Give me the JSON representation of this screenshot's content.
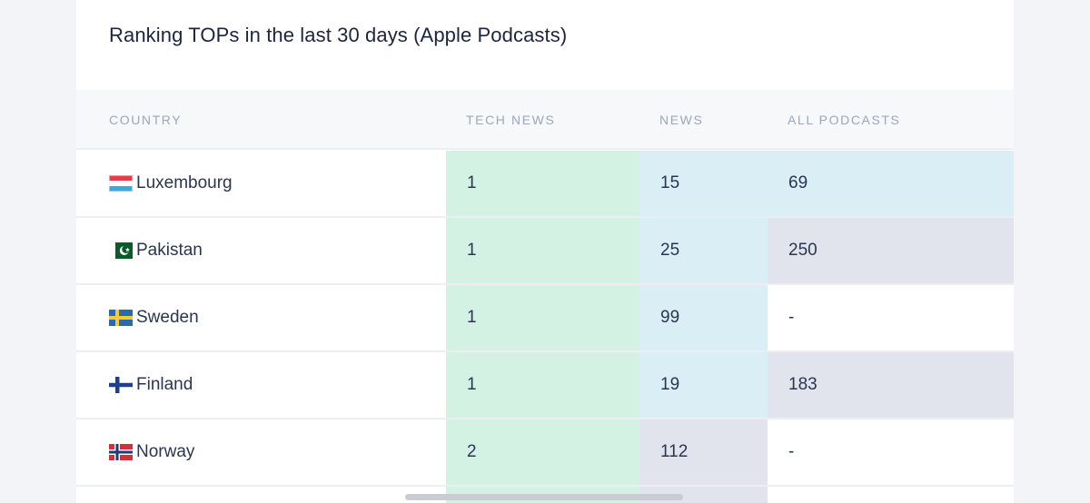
{
  "title": "Ranking TOPs in the last 30 days (Apple Podcasts)",
  "columns": {
    "country": "COUNTRY",
    "tech_news": "TECH NEWS",
    "news": "NEWS",
    "all_podcasts": "ALL PODCASTS"
  },
  "colors": {
    "tech_news_bg": "#d4f2e4",
    "news_bg": "#daeef6",
    "all_podcasts_bg": "#daeef6",
    "high_rank_bg": "#e1e4ec",
    "empty_bg": "#ffffff"
  },
  "rows": [
    {
      "country": "Luxembourg",
      "flag": "luxembourg-flag-icon",
      "tech_news": "1",
      "news": "15",
      "all_podcasts": "69",
      "news_tone": "blue",
      "all_tone": "blue"
    },
    {
      "country": "Pakistan",
      "flag": "pakistan-flag-icon",
      "tech_news": "1",
      "news": "25",
      "all_podcasts": "250",
      "news_tone": "blue",
      "all_tone": "gray"
    },
    {
      "country": "Sweden",
      "flag": "sweden-flag-icon",
      "tech_news": "1",
      "news": "99",
      "all_podcasts": "-",
      "news_tone": "blue",
      "all_tone": "none"
    },
    {
      "country": "Finland",
      "flag": "finland-flag-icon",
      "tech_news": "1",
      "news": "19",
      "all_podcasts": "183",
      "news_tone": "blue",
      "all_tone": "gray"
    },
    {
      "country": "Norway",
      "flag": "norway-flag-icon",
      "tech_news": "2",
      "news": "112",
      "all_podcasts": "-",
      "news_tone": "gray",
      "all_tone": "none"
    }
  ]
}
